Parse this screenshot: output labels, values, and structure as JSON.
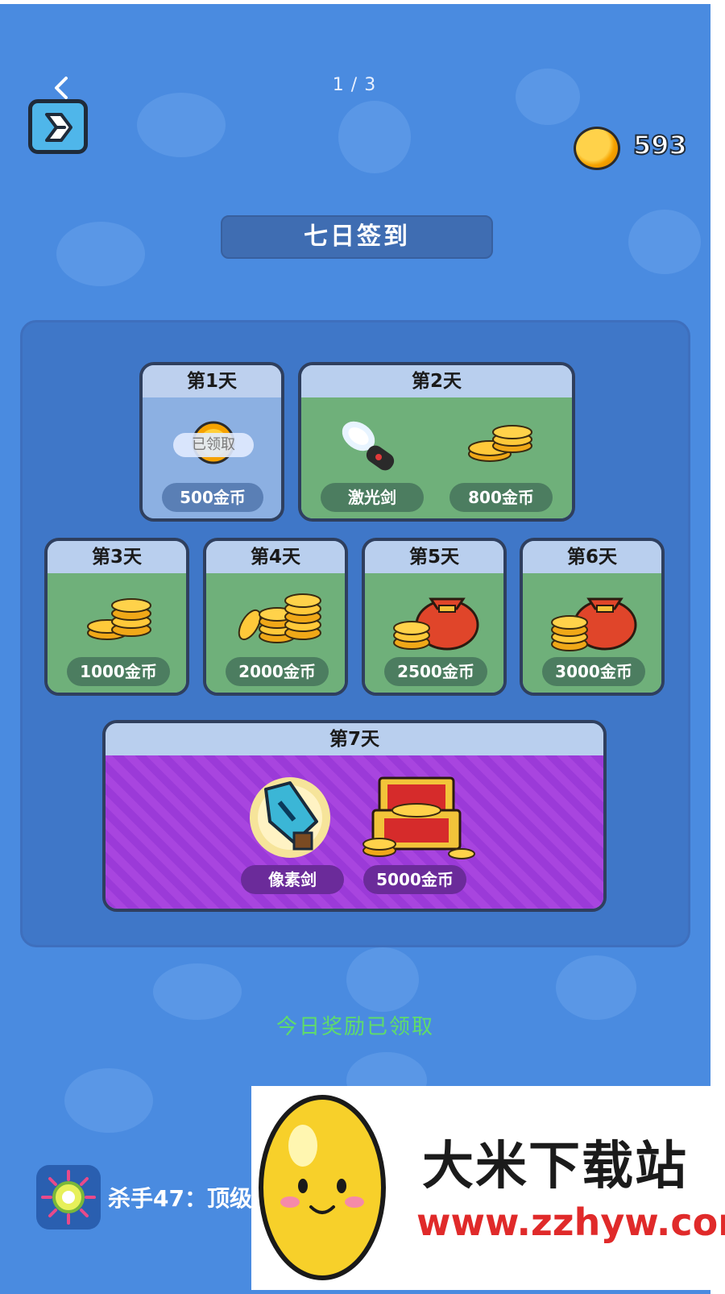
{
  "header": {
    "page_indicator": "1 / 3",
    "coins": "593"
  },
  "title": "七日签到",
  "days": [
    {
      "label": "第1天",
      "claimed": true,
      "claimed_badge": "已领取",
      "rewards": [
        "500金币"
      ]
    },
    {
      "label": "第2天",
      "rewards": [
        "激光剑",
        "800金币"
      ]
    },
    {
      "label": "第3天",
      "rewards": [
        "1000金币"
      ]
    },
    {
      "label": "第4天",
      "rewards": [
        "2000金币"
      ]
    },
    {
      "label": "第5天",
      "rewards": [
        "2500金币"
      ]
    },
    {
      "label": "第6天",
      "rewards": [
        "3000金币"
      ]
    },
    {
      "label": "第7天",
      "rewards": [
        "像素剑",
        "5000金币"
      ]
    }
  ],
  "status": "今日奖励已领取",
  "bottom_app": {
    "name": "杀手47：顶级"
  },
  "watermark": {
    "title": "大米下载站",
    "url": "www.zzhyw.com"
  },
  "colors": {
    "background": "#4a8be0",
    "status_green": "#5fdc6a",
    "day7_purple": "#9b3ad8"
  }
}
